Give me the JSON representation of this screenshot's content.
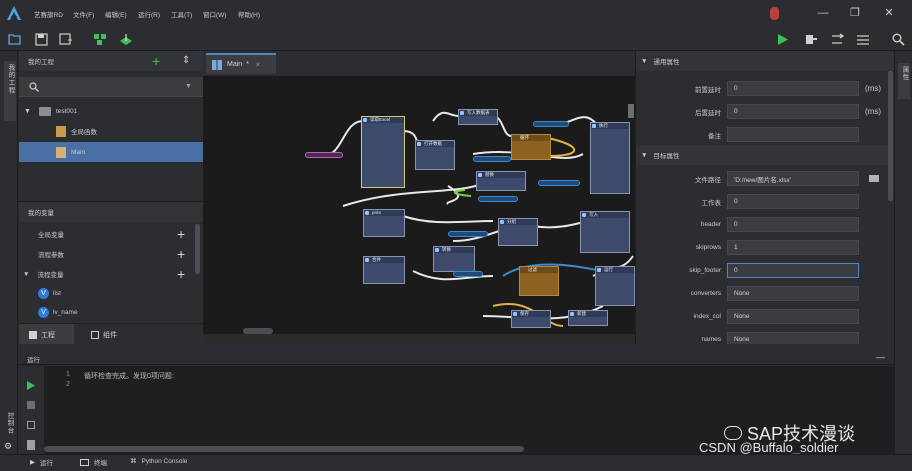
{
  "app": {
    "menu": [
      "艺赛旗RD",
      "文件(F)",
      "编辑(E)",
      "运行(R)",
      "工具(T)",
      "窗口(W)",
      "帮助(H)"
    ],
    "window_controls": [
      "minimize",
      "maximize",
      "close"
    ]
  },
  "left_strip": {
    "label": "我的工程"
  },
  "right_strip": {
    "label": "属性"
  },
  "project_panel": {
    "title": "我的工程",
    "tree": [
      {
        "label": "test001",
        "level": 0
      },
      {
        "label": "全局函数",
        "level": 1
      },
      {
        "label": "Main",
        "level": 1,
        "selected": true
      }
    ]
  },
  "variables_panel": {
    "title": "我的变量",
    "items": [
      {
        "label": "全局变量"
      },
      {
        "label": "流程参数"
      },
      {
        "label": "流程变量"
      },
      {
        "label": "list"
      },
      {
        "label": "lv_name"
      }
    ]
  },
  "left_tabs": [
    "工程",
    "组件"
  ],
  "editor": {
    "tab_label": "Main",
    "tab_modified": "*",
    "nodes": [
      "读取Excel",
      "打开数据",
      "写入数据表",
      "循环",
      "执行",
      "替换",
      "print",
      "分组",
      "写入",
      "合并",
      "转换",
      "过滤",
      "保存",
      "新建",
      "运行"
    ]
  },
  "properties": {
    "section_general": "通用属性",
    "section_target": "目标属性",
    "rows_general": [
      {
        "label": "前置延时",
        "value": "0",
        "unit": "(ms)"
      },
      {
        "label": "后置延时",
        "value": "0",
        "unit": "(ms)"
      },
      {
        "label": "备注",
        "value": ""
      }
    ],
    "rows_target": [
      {
        "label": "文件路径",
        "value": "'D:/new/图片名.xlsx'"
      },
      {
        "label": "工作表",
        "value": "0"
      },
      {
        "label": "header",
        "value": "0"
      },
      {
        "label": "skiprows",
        "value": "1"
      },
      {
        "label": "skip_footer",
        "value": "0",
        "active": true
      },
      {
        "label": "converters",
        "value": "None"
      },
      {
        "label": "index_col",
        "value": "None"
      },
      {
        "label": "names",
        "value": "None"
      }
    ]
  },
  "run_panel": {
    "title": "运行",
    "lines": [
      {
        "num": "1",
        "text": "循环检查完成。发现0项问题:"
      },
      {
        "num": "2",
        "text": ""
      }
    ]
  },
  "bottom_tabs": [
    "运行",
    "终端",
    "Python Console"
  ],
  "side_label": "控制台",
  "watermark": {
    "line1": "SAP技术漫谈",
    "line2": "CSDN @Buffalo_soldier"
  },
  "colors": {
    "accent_green": "#3cc15a",
    "accent_blue": "#4e86c9",
    "selected_row": "#4a6fa5"
  }
}
